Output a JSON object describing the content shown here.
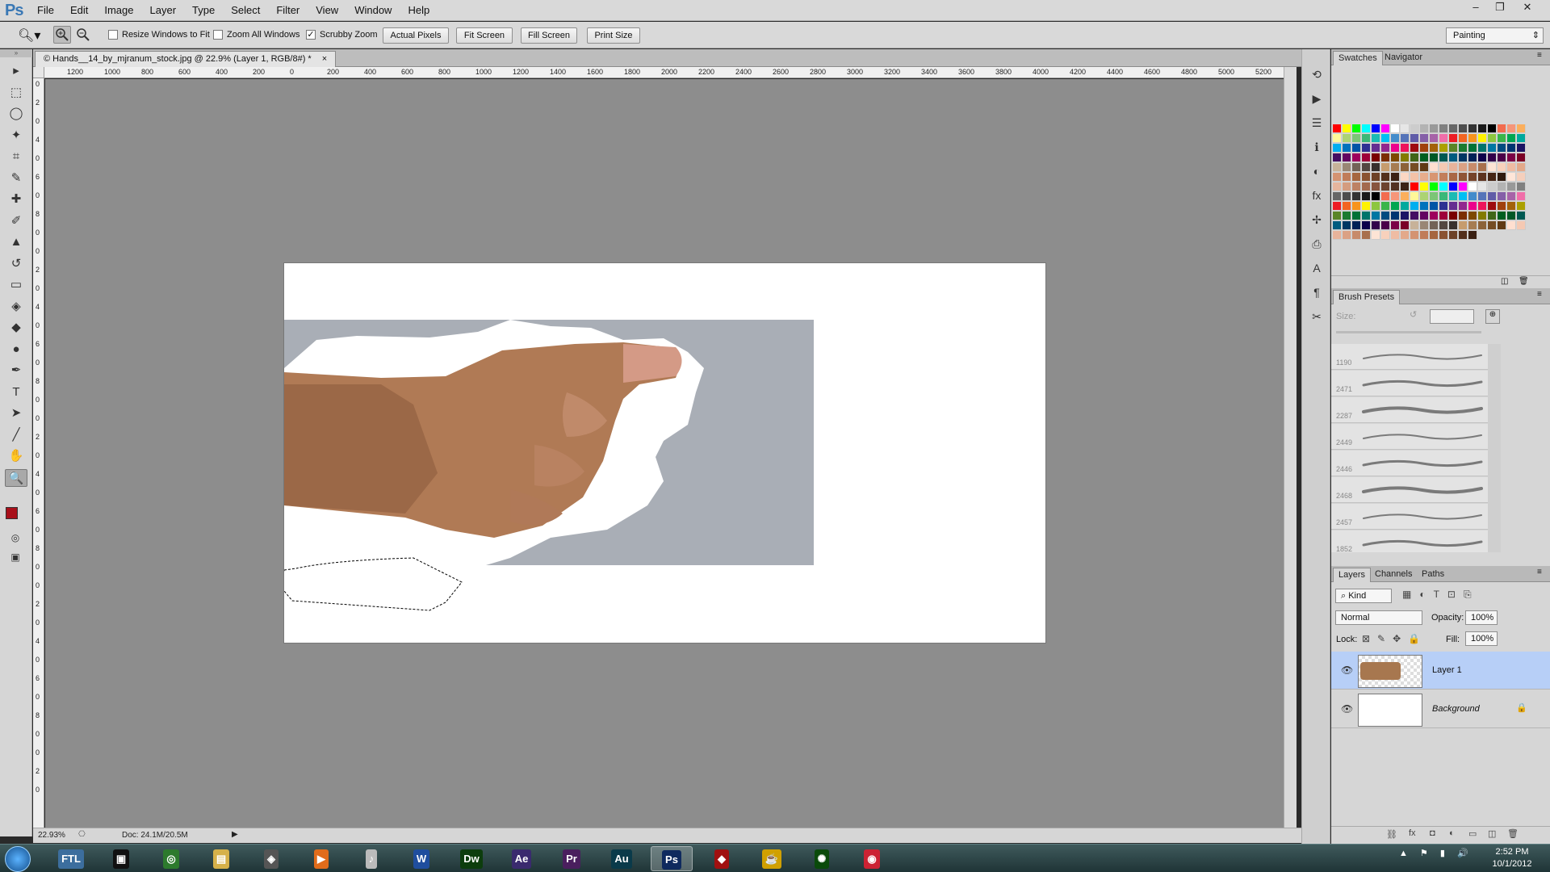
{
  "app": {
    "logo": "Ps"
  },
  "menu": [
    "File",
    "Edit",
    "Image",
    "Layer",
    "Type",
    "Select",
    "Filter",
    "View",
    "Window",
    "Help"
  ],
  "window_controls": {
    "minimize": "–",
    "restore": "❐",
    "close": "✕"
  },
  "options": {
    "resize_windows": "Resize Windows to Fit",
    "zoom_all": "Zoom All Windows",
    "scrubby_zoom": "Scrubby Zoom",
    "scrubby_checked": "✓",
    "actual_pixels": "Actual Pixels",
    "fit_screen": "Fit Screen",
    "fill_screen": "Fill Screen",
    "print_size": "Print Size",
    "workspace": "Painting",
    "workspace_arrow": "⇕"
  },
  "document": {
    "tab_title": "© Hands__14_by_mjranum_stock.jpg @ 22.9% (Layer 1, RGB/8#) *",
    "tab_close": "×",
    "zoom": "22.93%",
    "doc_size": "Doc: 24.1M/20.5M"
  },
  "ruler_h": [
    "1200",
    "1000",
    "800",
    "600",
    "400",
    "200",
    "0",
    "200",
    "400",
    "600",
    "800",
    "1000",
    "1200",
    "1400",
    "1600",
    "1800",
    "2000",
    "2200",
    "2400",
    "2600",
    "2800",
    "3000",
    "3200",
    "3400",
    "3600",
    "3800",
    "4000",
    "4200",
    "4400",
    "4600",
    "4800",
    "5000",
    "5200"
  ],
  "ruler_v": [
    "0",
    "2",
    "0",
    "4",
    "0",
    "6",
    "0",
    "8",
    "0",
    "0",
    "2",
    "0",
    "4",
    "0",
    "6",
    "0",
    "8",
    "0",
    "0",
    "2",
    "0",
    "4",
    "0",
    "6",
    "0",
    "8",
    "0",
    "0",
    "2",
    "0",
    "4",
    "0",
    "6",
    "0",
    "8",
    "0",
    "0",
    "2",
    "0"
  ],
  "tools": [
    {
      "name": "move-tool",
      "glyph": "▸"
    },
    {
      "name": "marquee-tool",
      "glyph": "⬚"
    },
    {
      "name": "lasso-tool",
      "glyph": "◯"
    },
    {
      "name": "quick-selection-tool",
      "glyph": "✦"
    },
    {
      "name": "crop-tool",
      "glyph": "⌗"
    },
    {
      "name": "eyedropper-tool",
      "glyph": "✎"
    },
    {
      "name": "healing-brush-tool",
      "glyph": "✚"
    },
    {
      "name": "brush-tool",
      "glyph": "✐"
    },
    {
      "name": "clone-stamp-tool",
      "glyph": "▲"
    },
    {
      "name": "history-brush-tool",
      "glyph": "↺"
    },
    {
      "name": "eraser-tool",
      "glyph": "▭"
    },
    {
      "name": "paint-bucket-tool",
      "glyph": "◈"
    },
    {
      "name": "blur-tool",
      "glyph": "◆"
    },
    {
      "name": "dodge-tool",
      "glyph": "●"
    },
    {
      "name": "pen-tool",
      "glyph": "✒"
    },
    {
      "name": "type-tool",
      "glyph": "T"
    },
    {
      "name": "path-selection-tool",
      "glyph": "➤"
    },
    {
      "name": "line-tool",
      "glyph": "╱"
    },
    {
      "name": "hand-tool",
      "glyph": "✋"
    },
    {
      "name": "zoom-tool",
      "glyph": "🔍"
    }
  ],
  "colors": {
    "foreground": "#a8101a",
    "background": "#ffffff",
    "selection_highlight": "#b7cff7"
  },
  "dock": [
    {
      "name": "history-icon",
      "glyph": "⟲"
    },
    {
      "name": "actions-icon",
      "glyph": "▶"
    },
    {
      "name": "properties-icon",
      "glyph": "☰"
    },
    {
      "name": "info-icon",
      "glyph": "ℹ"
    },
    {
      "name": "adjustments-icon",
      "glyph": "◐"
    },
    {
      "name": "styles-icon",
      "glyph": "fx"
    },
    {
      "name": "brush-icon",
      "glyph": "✢"
    },
    {
      "name": "clone-source-icon",
      "glyph": "⎙"
    },
    {
      "name": "character-icon",
      "glyph": "A"
    },
    {
      "name": "paragraph-icon",
      "glyph": "¶"
    },
    {
      "name": "tool-presets-icon",
      "glyph": "✂"
    }
  ],
  "panels": {
    "swatches_tabs": [
      "Swatches",
      "Navigator"
    ],
    "brush_presets": {
      "title": "Brush Presets",
      "size_label": "Size:",
      "sizes": [
        "1190",
        "2471",
        "2287",
        "2449",
        "2446",
        "2468",
        "2457",
        "1852"
      ]
    },
    "layers_tabs": [
      "Layers",
      "Channels",
      "Paths"
    ],
    "kind": "Kind",
    "blend_mode": "Normal",
    "opacity_label": "Opacity:",
    "opacity": "100%",
    "lock_label": "Lock:",
    "fill_label": "Fill:",
    "fill": "100%",
    "layers": [
      {
        "name": "Layer 1",
        "selected": true
      },
      {
        "name": "Background",
        "selected": false
      }
    ]
  },
  "swatches": [
    [
      "#ff0000",
      "#ffff00",
      "#00ff00",
      "#00ffff",
      "#0000ff",
      "#ff00ff",
      "#ffffff",
      "#e6e6e6",
      "#cccccc",
      "#b3b3b3",
      "#999999",
      "#808080",
      "#666666",
      "#4d4d4d",
      "#333333",
      "#1a1a1a",
      "#000000",
      "#f26c4f",
      "#f69679",
      "#fbaf5d",
      "#fff799",
      "#acd373",
      "#7cc576",
      "#3bb878",
      "#1abbb4",
      "#00bff3",
      "#438ccb",
      "#5574b9",
      "#605ca8",
      "#855fa8",
      "#a763a8",
      "#f06ea9"
    ],
    [
      "#ed1c24",
      "#f26522",
      "#f7941d",
      "#fff200",
      "#8dc63f",
      "#39b54a",
      "#00a651",
      "#00a99d",
      "#00aeef",
      "#0072bc",
      "#0054a6",
      "#2e3192",
      "#662d91",
      "#92278f",
      "#ec008c",
      "#ed145b",
      "#9e0b0f",
      "#a0410d",
      "#a36209",
      "#aba000",
      "#598527",
      "#1a7b30",
      "#007236",
      "#00746b",
      "#0076a3",
      "#004b80",
      "#003471",
      "#1b1464",
      "#440e62",
      "#630460",
      "#9e005d",
      "#9e0039"
    ],
    [
      "#790000",
      "#7b2e00",
      "#7d4900",
      "#827b00",
      "#406618",
      "#005e20",
      "#005826",
      "#005952",
      "#005b7f",
      "#003663",
      "#002157",
      "#0d004c",
      "#32004b",
      "#4b0049",
      "#7b0046",
      "#7a0026",
      "#c7b299",
      "#998675",
      "#736357",
      "#534741",
      "#37302d",
      "#c69c6d",
      "#a67c52",
      "#8c6239",
      "#754c24",
      "#603913",
      "#ffdfd0",
      "#f5c9b3",
      "#e8b39b",
      "#dba184",
      "#c78b6b",
      "#a8704d"
    ],
    [
      "#fde4d5",
      "#f8d1bc",
      "#efbca3",
      "#e3a98a",
      "#d49372",
      "#c07c59",
      "#a6663f",
      "#8a5332",
      "#6d4126",
      "#53301c",
      "#3b2113",
      "#fbd7c3",
      "#f3c2a7",
      "#e7ad8c",
      "#d89672",
      "#c27e5b",
      "#a96746",
      "#8f5436",
      "#75432a",
      "#5c331f",
      "#452515",
      "#2f1a0f",
      "#ffe6d9",
      "#f5cfbc",
      "#e6b59d",
      "#d49c7f",
      "#bd8264",
      "#a36a4f",
      "#87553e",
      "#6c432f",
      "#523222",
      "#3a2317"
    ]
  ],
  "taskbar": {
    "apps": [
      "FTL",
      "Terminal",
      "CCleaner",
      "Explorer",
      "Game",
      "VLC",
      "iTunes",
      "Word",
      "Dw",
      "Ae",
      "Pr",
      "Au",
      "Ps",
      "Flash",
      "Java",
      "Razer",
      "Chrome"
    ],
    "clock_time": "2:52 PM",
    "clock_date": "10/1/2012"
  }
}
